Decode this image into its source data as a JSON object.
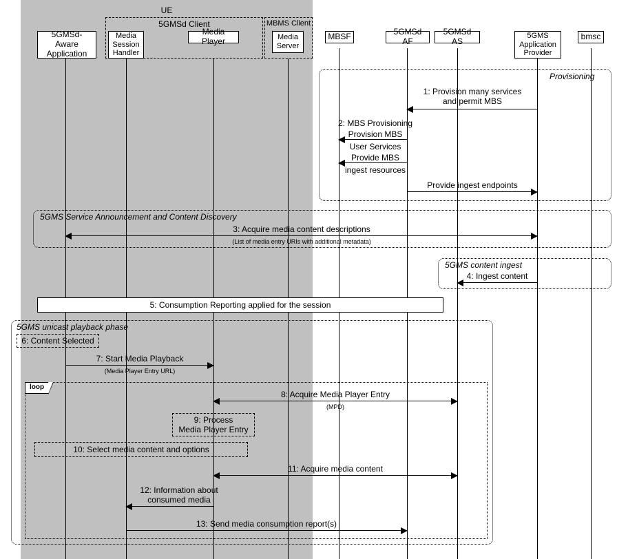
{
  "participants": {
    "ue": "UE",
    "client5gmsd": "5GMSd Client",
    "mbmsclient": "MBMS Client",
    "p1": "5GMSd-Aware\nApplication",
    "p2": "Media\nSession\nHandler",
    "p3": "Media Player",
    "p4": "Media\nServer",
    "p5": "MBSF",
    "p6": "5GMSd AF",
    "p7": "5GMSd AS",
    "p8": "5GMS\nApplication\nProvider",
    "p9": "bmsc"
  },
  "regions": {
    "provisioning": "Provisioning",
    "announcement": "5GMS Service Announcement and Content Discovery",
    "ingest": "5GMS content ingest",
    "playback": "5GMS unicast playback phase",
    "loop": "loop"
  },
  "messages": {
    "m1": "1: Provision many services\nand permit MBS",
    "m2": "2: MBS Provisioning",
    "m2a": "Provision MBS",
    "m2b": "User Services",
    "m2c": "Provide MBS",
    "m2d": "ingest resources",
    "m2e": "Provide ingest endpoints",
    "m3": "3: Acquire media content descriptions",
    "m3sub": "(List of media entry URIs with additional metadata)",
    "m4": "4: Ingest content",
    "m5": "5: Consumption Reporting applied for the session",
    "m6": "6: Content Selected",
    "m7": "7: Start Media Playback",
    "m7sub": "(Media Player Entry URL)",
    "m8": "8: Acquire Media Player Entry",
    "m8sub": "(MPD)",
    "m9": "9: Process\nMedia Player Entry",
    "m10": "10: Select media content and options",
    "m11": "11: Acquire media content",
    "m12": "12: Information about\nconsumed media",
    "m13": "13: Send media consumption report(s)"
  }
}
